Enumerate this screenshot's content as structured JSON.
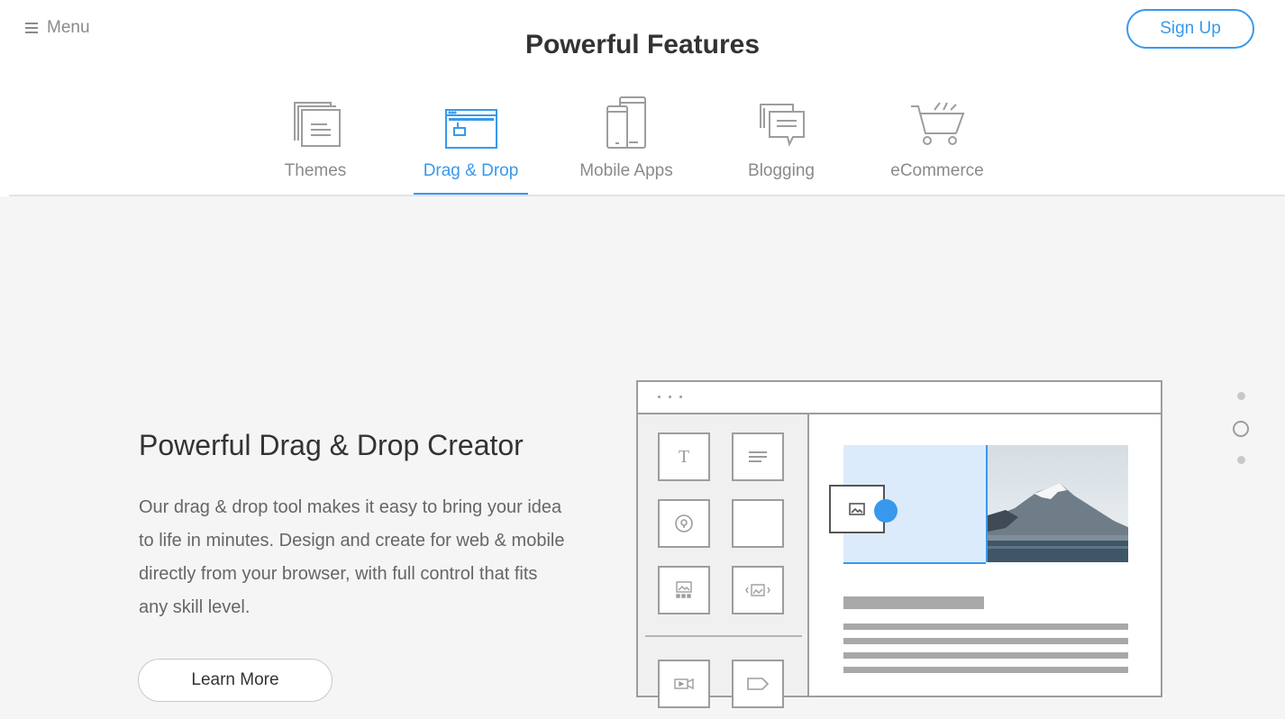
{
  "header": {
    "menu_label": "Menu",
    "title": "Powerful Features",
    "signup_label": "Sign Up"
  },
  "tabs": [
    {
      "label": "Themes",
      "icon": "themes-icon",
      "active": false
    },
    {
      "label": "Drag & Drop",
      "icon": "drag-drop-icon",
      "active": true
    },
    {
      "label": "Mobile Apps",
      "icon": "mobile-apps-icon",
      "active": false
    },
    {
      "label": "Blogging",
      "icon": "blogging-icon",
      "active": false
    },
    {
      "label": "eCommerce",
      "icon": "ecommerce-icon",
      "active": false
    }
  ],
  "feature": {
    "headline": "Powerful Drag & Drop Creator",
    "description": "Our drag & drop tool makes it easy to bring your idea to life in minutes. Design and create for web & mobile directly from your browser, with full control that fits any skill level.",
    "cta_label": "Learn More"
  },
  "illustration": {
    "tile_text_glyph": "T",
    "tile_icons": [
      "text-tile-icon",
      "paragraph-tile-icon",
      "map-pin-tile-icon",
      "blank-tile-icon",
      "gallery-tile-icon",
      "slider-tile-icon",
      "video-tile-icon",
      "tag-tile-icon"
    ]
  },
  "pager": {
    "count": 3,
    "active_index": 1
  },
  "colors": {
    "accent": "#3899ec",
    "muted_text": "#8a8a8a",
    "content_bg": "#f5f5f5",
    "dropzone": "#dcebfb"
  }
}
